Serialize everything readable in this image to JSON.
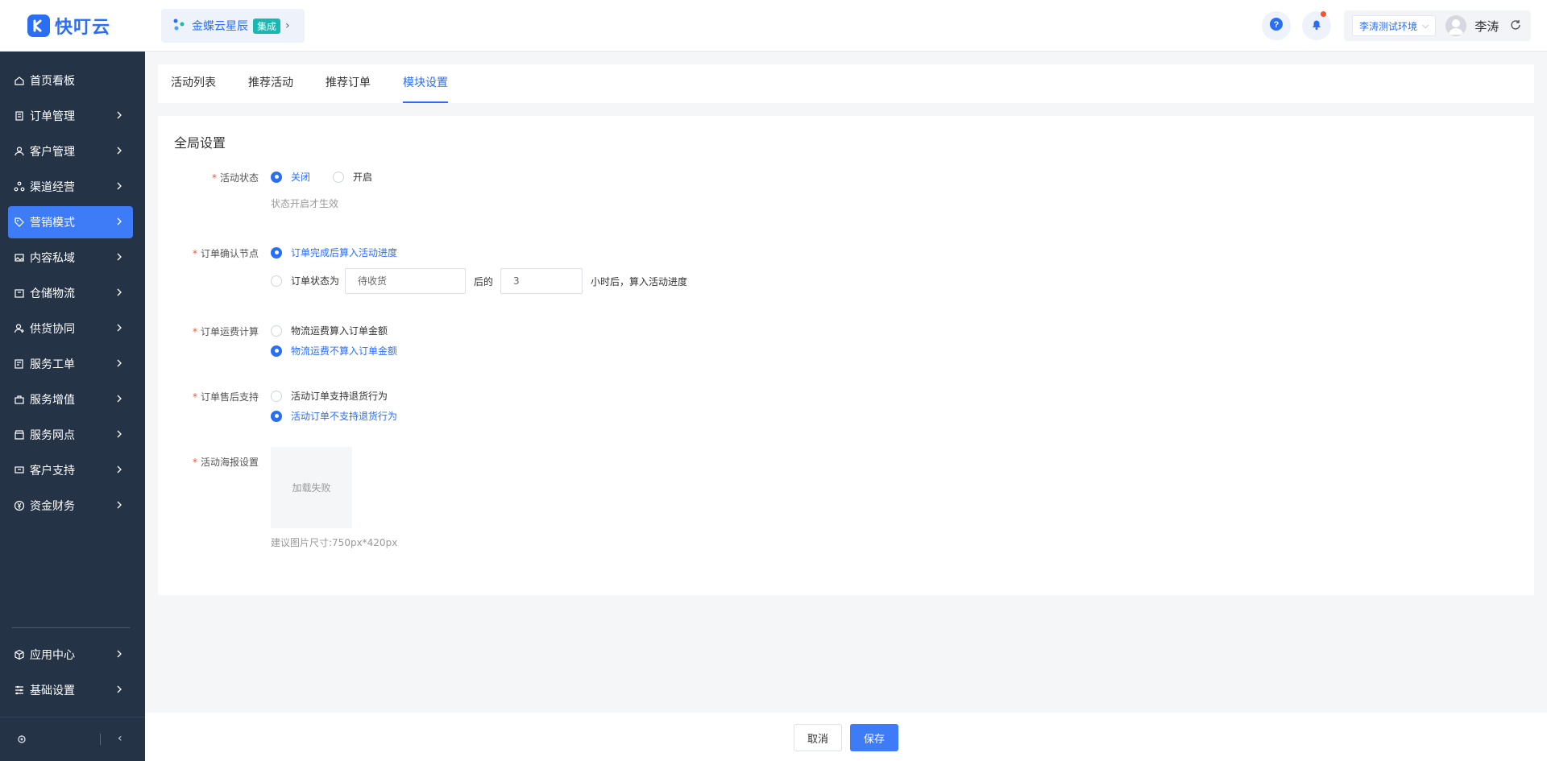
{
  "header": {
    "logo_text": "快叮云",
    "integration_name": "金蝶云星辰",
    "integration_badge": "集成",
    "environment": "李涛测试环境",
    "user_name": "李涛"
  },
  "sidebar": {
    "items": [
      {
        "label": "首页看板",
        "icon": "home-icon"
      },
      {
        "label": "订单管理",
        "icon": "clipboard-icon"
      },
      {
        "label": "客户管理",
        "icon": "user-icon"
      },
      {
        "label": "渠道经营",
        "icon": "network-icon"
      },
      {
        "label": "营销模式",
        "icon": "tag-icon"
      },
      {
        "label": "内容私域",
        "icon": "image-icon"
      },
      {
        "label": "仓储物流",
        "icon": "box-icon"
      },
      {
        "label": "供货协同",
        "icon": "supplier-icon"
      },
      {
        "label": "服务工单",
        "icon": "ticket-icon"
      },
      {
        "label": "服务增值",
        "icon": "bag-icon"
      },
      {
        "label": "服务网点",
        "icon": "store-icon"
      },
      {
        "label": "客户支持",
        "icon": "support-icon"
      },
      {
        "label": "资金财务",
        "icon": "yen-icon"
      }
    ],
    "bottom_items": [
      {
        "label": "应用中心",
        "icon": "cube-icon"
      },
      {
        "label": "基础设置",
        "icon": "sliders-icon"
      }
    ]
  },
  "tabs": [
    "活动列表",
    "推荐活动",
    "推荐订单",
    "模块设置"
  ],
  "panel": {
    "title": "全局设置",
    "activity_status": {
      "label": "活动状态",
      "option_off": "关闭",
      "option_on": "开启",
      "hint": "状态开启才生效"
    },
    "order_confirm": {
      "label": "订单确认节点",
      "option_complete": "订单完成后算入活动进度",
      "option_status_prefix": "订单状态为",
      "status_value": "待收货",
      "after_text": "后的",
      "hours_value": "3",
      "suffix": "小时后，算入活动进度"
    },
    "freight": {
      "label": "订单运费计算",
      "option_include": "物流运费算入订单金额",
      "option_exclude": "物流运费不算入订单金额"
    },
    "after_sale": {
      "label": "订单售后支持",
      "option_support": "活动订单支持退货行为",
      "option_no_support": "活动订单不支持退货行为"
    },
    "poster": {
      "label": "活动海报设置",
      "placeholder": "加载失败",
      "hint": "建议图片尺寸:750px*420px"
    }
  },
  "footer": {
    "cancel": "取消",
    "save": "保存"
  },
  "colors": {
    "primary": "#2b6ef6",
    "sidebar_bg": "#243346",
    "sidebar_active": "#3d7bf7",
    "required": "#f5532d",
    "badge": "#18b8b0"
  }
}
